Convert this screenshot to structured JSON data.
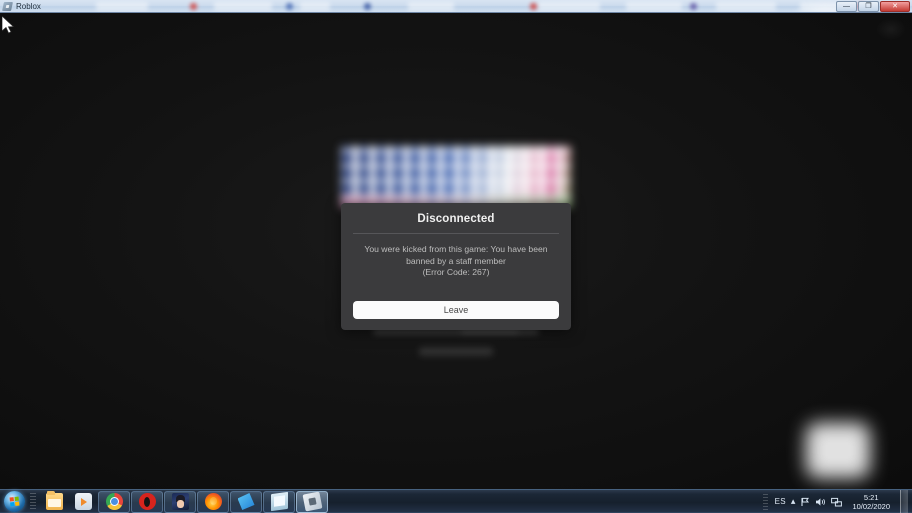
{
  "window": {
    "title": "Roblox",
    "icon": "roblox-icon",
    "buttons": {
      "minimize": "—",
      "restore": "❐",
      "close": "✕"
    }
  },
  "dialog": {
    "title": "Disconnected",
    "message": "You were kicked from this game: You have been\nbanned by a staff member\n(Error Code: 267)",
    "error_code": "267",
    "button_label": "Leave",
    "background_color": "#3b3b3d",
    "button_color": "#fbfbfb"
  },
  "taskbar": {
    "start_label": "Start",
    "items": [
      {
        "name": "windows-explorer",
        "label": "Windows Explorer"
      },
      {
        "name": "windows-media-player",
        "label": "Windows Media Player"
      },
      {
        "name": "google-chrome",
        "label": "Google Chrome"
      },
      {
        "name": "opera-browser",
        "label": "Opera"
      },
      {
        "name": "avatar-app",
        "label": "Avatar"
      },
      {
        "name": "mozilla-firefox",
        "label": "Mozilla Firefox"
      },
      {
        "name": "blue-app",
        "label": "Blue App"
      },
      {
        "name": "notebook-app",
        "label": "Notebook"
      },
      {
        "name": "roblox-player",
        "label": "Roblox"
      }
    ],
    "tray": {
      "language": "ES",
      "show_hidden": "▴",
      "flag_icon": "flag-icon",
      "volume_icon": "speaker-icon",
      "network_icon": "network-icon",
      "time": "5:21",
      "date": "10/02/2020"
    }
  }
}
